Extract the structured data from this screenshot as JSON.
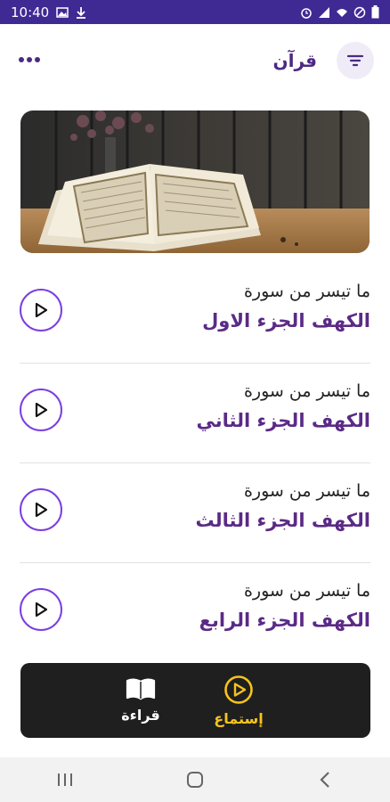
{
  "status_bar": {
    "time": "10:40",
    "indicators": [
      "image-icon",
      "download-icon",
      "alarm-icon",
      "signal-icon",
      "wifi-icon",
      "dnd-icon",
      "battery-icon"
    ]
  },
  "app_bar": {
    "title": "قرآن",
    "more_icon": "more-horizontal-icon",
    "filter_icon": "filter-icon"
  },
  "banner": {
    "description_icon": "quran-book-image"
  },
  "list": [
    {
      "subtitle": "ما تيسر من سورة",
      "title": "الكهف الجزء الاول"
    },
    {
      "subtitle": "ما تيسر من سورة",
      "title": "الكهف الجزء الثاني"
    },
    {
      "subtitle": "ما تيسر من سورة",
      "title": "الكهف الجزء الثالث"
    },
    {
      "subtitle": "ما تيسر من سورة",
      "title": "الكهف الجزء الرابع"
    }
  ],
  "bottom_nav": {
    "listen_label": "إستماع",
    "read_label": "قراءة",
    "active_color": "#f6c31c",
    "inactive_color": "#ffffff"
  },
  "colors": {
    "status_bar": "#3f2a93",
    "accent": "#7c3fe0",
    "title_purple": "#5b2a86"
  }
}
